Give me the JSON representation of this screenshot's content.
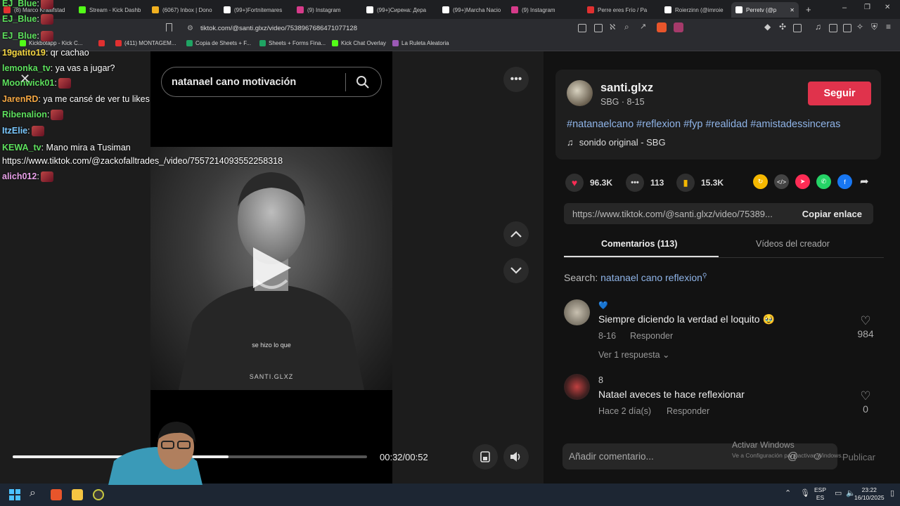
{
  "browser": {
    "tabs": [
      {
        "label": "(8) Marco Kraalfstad",
        "color": "#e03030"
      },
      {
        "label": "Stream - Kick Dashb",
        "color": "#53fc18"
      },
      {
        "label": "(6067) Inbox | Dono",
        "color": "#f0b020"
      },
      {
        "label": "(99+)Fortnitemares",
        "color": "#ffffff"
      },
      {
        "label": "(9) Instagram",
        "color": "#d63b8a"
      },
      {
        "label": "(99+)Сирена: Дера",
        "color": "#ffffff"
      },
      {
        "label": "(99+)Marcha Nacio",
        "color": "#ffffff"
      },
      {
        "label": "(9) Instagram",
        "color": "#d63b8a"
      },
      {
        "label": "Perre eres Frío / Pa",
        "color": "#e03030"
      },
      {
        "label": "Roierzinn (@imroie",
        "color": "#ffffff"
      },
      {
        "label": "Perretv (@p",
        "color": "#ffffff"
      }
    ],
    "url": "tiktok.com/@santi.glxz/video/7538967686471077128",
    "bookmarks": [
      {
        "label": "Kickbotapp - Kick C...",
        "color": "#53fc18"
      },
      {
        "label": "",
        "color": "#e03030"
      },
      {
        "label": "(411) MONTAGEM...",
        "color": "#e03030"
      },
      {
        "label": "Copia de Sheets + F...",
        "color": "#1fa463"
      },
      {
        "label": "Sheets + Forms Fina...",
        "color": "#1fa463"
      },
      {
        "label": "Kick Chat Overlay",
        "color": "#53fc18"
      },
      {
        "label": "La Ruleta Aleatoria",
        "color": "#9b59b6"
      }
    ],
    "window_controls": [
      "–",
      "❐",
      "✕"
    ]
  },
  "chat": [
    {
      "user": "EJ_Blue",
      "color": "#5de05d",
      "sep": ":",
      "msg": "",
      "emote": true
    },
    {
      "user": "EJ_Blue",
      "color": "#5de05d",
      "sep": ":",
      "msg": "",
      "emote": true
    },
    {
      "user": "EJ_Blue",
      "color": "#5de05d",
      "sep": ":",
      "msg": "",
      "emote": true
    },
    {
      "user": "19gatito19",
      "color": "#f5d742",
      "sep": ":",
      "msg": " qr cachao",
      "emote": false
    },
    {
      "user": "lemonka_tv",
      "color": "#5de05d",
      "sep": ":",
      "msg": " ya vas a jugar?",
      "emote": false
    },
    {
      "user": "Moonwick01",
      "color": "#5de05d",
      "sep": ":",
      "msg": "",
      "emote": true
    },
    {
      "user": "JarenRD",
      "color": "#f5a742",
      "sep": ":",
      "msg": " ya me cansé de ver tu likes",
      "emote": false
    },
    {
      "user": "Ribenalion",
      "color": "#5de05d",
      "sep": ":",
      "msg": "",
      "emote": true
    },
    {
      "user": "ItzElie",
      "color": "#7ac8ff",
      "sep": ":",
      "msg": "",
      "emote": true
    },
    {
      "user": "KEWA_tv",
      "color": "#5de05d",
      "sep": ":",
      "msg": " Mano mira a Tusiman",
      "emote": false
    },
    {
      "user": "",
      "color": "#ffffff",
      "sep": "",
      "msg": "https://www.tiktok.com/@zackofalltrades_/video/7557214093552258318",
      "emote": false
    },
    {
      "user": "alich012",
      "color": "#e8a0e8",
      "sep": ":",
      "msg": "",
      "emote": true
    }
  ],
  "video": {
    "search_query": "natanael cano motivación",
    "subtitle": "se hizo lo que",
    "watermark": "SANTI.GLXZ",
    "time": "00:32/00:52",
    "progress": 0.61
  },
  "creator": {
    "username": "santi.glxz",
    "subline": "SBG · 8-15",
    "follow_label": "Seguir",
    "hashtags": "#natanaelcano #reflexion #fyp #realidad #amistadessinceras",
    "sound": "sonido original - SBG"
  },
  "stats": {
    "likes": "96.3K",
    "comments": "113",
    "saves": "15.3K"
  },
  "share_colors": [
    "#f5b800",
    "#444444",
    "#fe2c55",
    "#25d366",
    "#1877f2"
  ],
  "link": {
    "url": "https://www.tiktok.com/@santi.glxz/video/75389...",
    "copy_label": "Copiar enlace"
  },
  "panel_tabs": {
    "comments": "Comentarios (113)",
    "creator_videos": "Vídeos del creador"
  },
  "search_suggest": {
    "prefix": "Search:",
    "term": "natanael cano reflexion"
  },
  "comments": [
    {
      "name": "💙",
      "text": "Siempre diciendo la verdad el loquito 🥹",
      "date": "8-16",
      "reply": "Responder",
      "likes": "984",
      "replies": "Ver 1 respuesta"
    },
    {
      "name": "8",
      "text": "Natael aveces te hace reflexionar",
      "date": "Hace 2 día(s)",
      "reply": "Responder",
      "likes": "0",
      "replies": ""
    }
  ],
  "comment_input": {
    "placeholder": "Añadir comentario...",
    "publish": "Publicar"
  },
  "windows_watermark": {
    "line1": "Activar Windows",
    "line2": "Ve a Configuración para activar Windows."
  },
  "taskbar": {
    "lang_top": "ESP",
    "lang_bottom": "ES",
    "time": "23:22",
    "date": "16/10/2025"
  }
}
